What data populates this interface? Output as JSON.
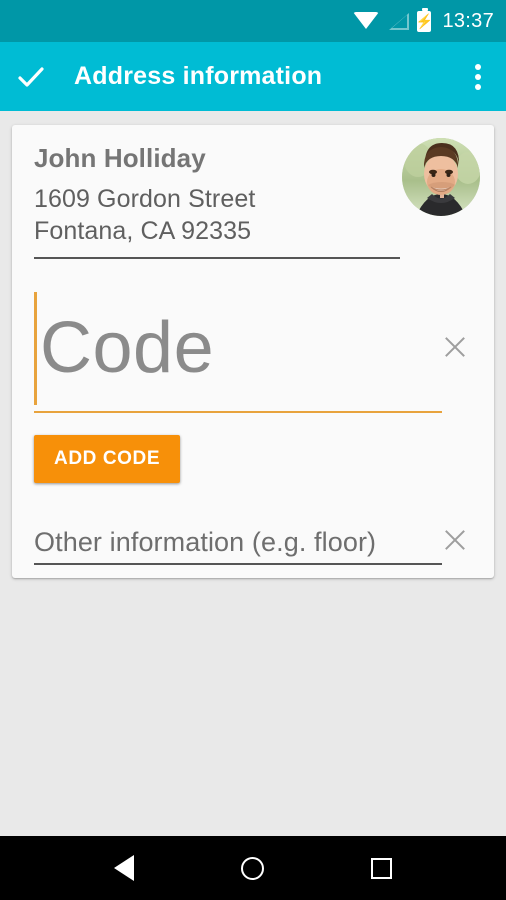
{
  "status_bar": {
    "time": "13:37",
    "icons": [
      "wifi-icon",
      "cell-signal-icon",
      "battery-charging-icon"
    ],
    "background_color": "#0097a7"
  },
  "app_bar": {
    "title": "Address information",
    "confirm_icon": "check-icon",
    "overflow_icon": "more-vertical-icon",
    "background_color": "#00bcd4",
    "text_color": "#ffffff"
  },
  "card": {
    "recipient_name": "John Holliday",
    "address_line_1": "1609 Gordon Street",
    "address_line_2": "Fontana, CA 92335",
    "avatar_icon": "user-photo-avatar",
    "background_color": "#fafafa"
  },
  "code_field": {
    "placeholder": "Code",
    "value": "",
    "focused": true,
    "accent_color": "#e8a33d",
    "clear_icon": "close-icon"
  },
  "add_code_button": {
    "label": "ADD CODE",
    "background_color": "#f79009",
    "text_color": "#ffffff"
  },
  "other_field": {
    "placeholder": "Other information (e.g. floor)",
    "value": "",
    "underline_color": "#555555",
    "clear_icon": "close-icon"
  },
  "nav_bar": {
    "back_icon": "back-triangle-icon",
    "home_icon": "home-circle-icon",
    "recents_icon": "recents-square-icon",
    "background_color": "#000000"
  }
}
